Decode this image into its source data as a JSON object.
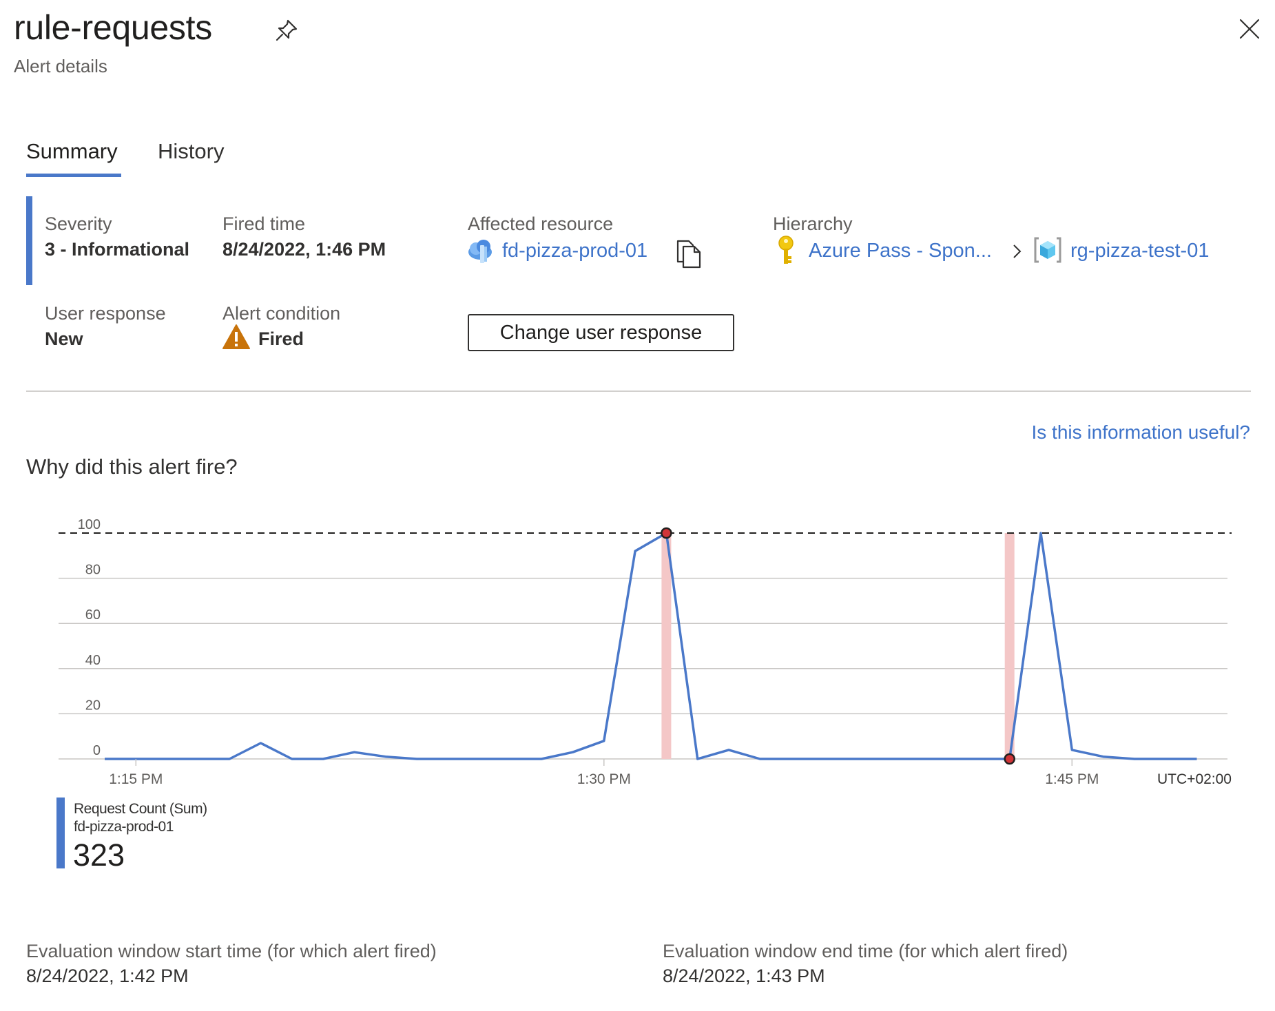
{
  "header": {
    "title": "rule-requests",
    "subtitle": "Alert details",
    "pin_icon": "pin-icon",
    "close_icon": "close-icon"
  },
  "tabs": [
    {
      "label": "Summary",
      "active": true
    },
    {
      "label": "History",
      "active": false
    }
  ],
  "summary": {
    "severity_label": "Severity",
    "severity_value": "3 - Informational",
    "fired_time_label": "Fired time",
    "fired_time_value": "8/24/2022, 1:46 PM",
    "affected_resource_label": "Affected resource",
    "affected_resource_value": "fd-pizza-prod-01",
    "hierarchy_label": "Hierarchy",
    "hierarchy_subscription": "Azure Pass - Spon...",
    "hierarchy_resource_group": "rg-pizza-test-01",
    "user_response_label": "User response",
    "user_response_value": "New",
    "alert_condition_label": "Alert condition",
    "alert_condition_value": "Fired",
    "change_button": "Change user response"
  },
  "feedback_link": "Is this information useful?",
  "why_heading": "Why did this alert fire?",
  "colors": {
    "accent": "#4a78c9",
    "link": "#3e73c9",
    "warning": "#c8730a",
    "alert_band": "#f4c7c7",
    "alert_point": "#d13438"
  },
  "chart_data": {
    "type": "line",
    "x": [
      "1:13",
      "1:14",
      "1:15",
      "1:16",
      "1:17",
      "1:18",
      "1:19",
      "1:20",
      "1:21",
      "1:22",
      "1:23",
      "1:24",
      "1:25",
      "1:26",
      "1:27",
      "1:28",
      "1:29",
      "1:30",
      "1:31",
      "1:32",
      "1:33",
      "1:34",
      "1:35",
      "1:36",
      "1:37",
      "1:38",
      "1:39",
      "1:40",
      "1:41",
      "1:42",
      "1:43",
      "1:44",
      "1:45",
      "1:46",
      "1:47",
      "1:48"
    ],
    "series": [
      {
        "name": "Request Count (Sum)",
        "resource": "fd-pizza-prod-01",
        "total": "323",
        "values": [
          0,
          0,
          0,
          0,
          0,
          7,
          0,
          0,
          3,
          1,
          0,
          0,
          0,
          0,
          0,
          3,
          8,
          92,
          100,
          0,
          4,
          0,
          0,
          0,
          0,
          0,
          0,
          0,
          0,
          0,
          100,
          4,
          1,
          0,
          0,
          0
        ]
      }
    ],
    "threshold": 100,
    "alert_points": [
      "1:31",
      "1:42"
    ],
    "ylim": [
      0,
      100
    ],
    "yticks": [
      "0",
      "20",
      "40",
      "60",
      "80",
      "100"
    ],
    "xticks": [
      {
        "at": "1:14",
        "label": "1:15 PM"
      },
      {
        "at": "1:29",
        "label": "1:30 PM"
      },
      {
        "at": "1:44",
        "label": "1:45 PM"
      }
    ],
    "timezone": "UTC+02:00",
    "grid": true
  },
  "legend": {
    "name": "Request Count (Sum)",
    "resource": "fd-pizza-prod-01",
    "total": "323"
  },
  "evaluation": {
    "start_label": "Evaluation window start time (for which alert fired)",
    "start_value": "8/24/2022, 1:42 PM",
    "end_label": "Evaluation window end time (for which alert fired)",
    "end_value": "8/24/2022, 1:43 PM"
  }
}
